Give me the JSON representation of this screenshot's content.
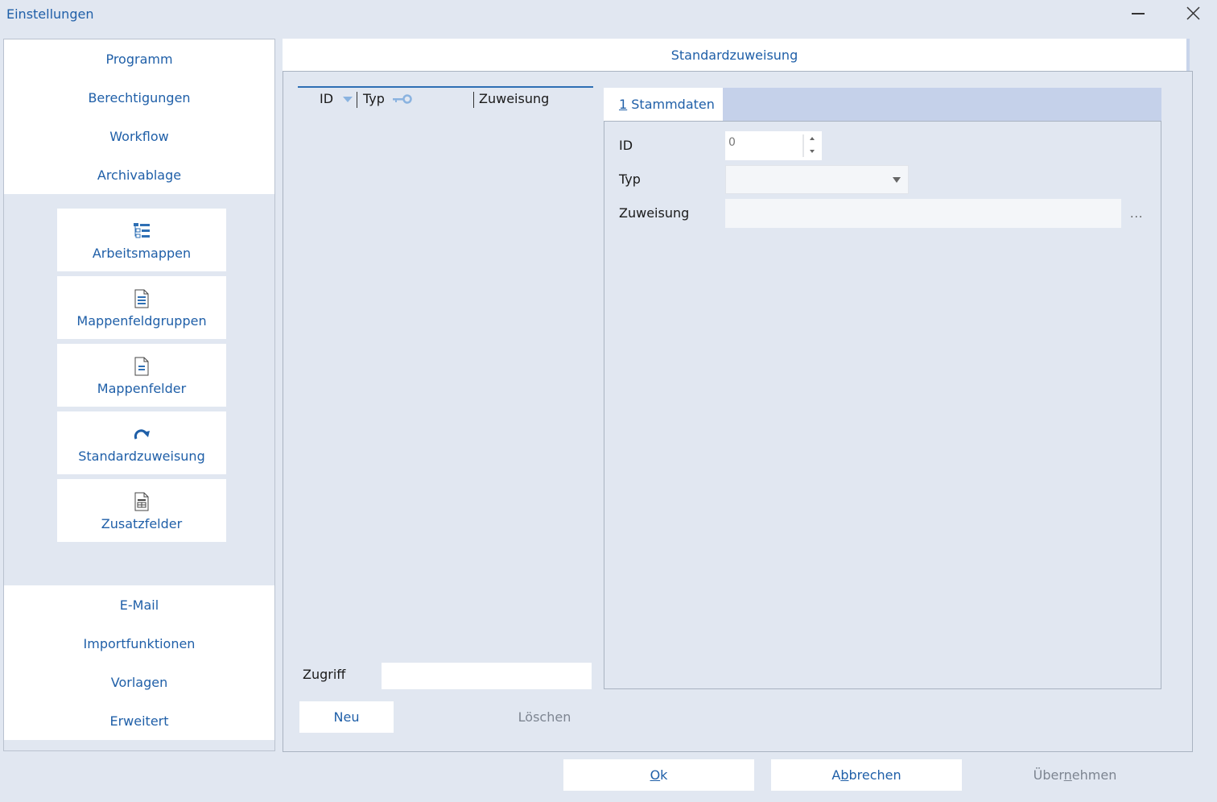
{
  "window": {
    "title": "Einstellungen"
  },
  "nav": {
    "top_items": [
      "Programm",
      "Berechtigungen",
      "Workflow",
      "Archivablage"
    ],
    "tiles": [
      "Arbeitsmappen",
      "Mappenfeldgruppen",
      "Mappenfelder",
      "Standardzuweisung",
      "Zusatzfelder"
    ],
    "bottom_items": [
      "E-Mail",
      "Importfunktionen",
      "Vorlagen",
      "Erweitert"
    ]
  },
  "panel": {
    "title": "Standardzuweisung"
  },
  "list": {
    "columns": [
      "ID",
      "Typ",
      "Zuweisung"
    ],
    "zugriff_label": "Zugriff",
    "zugriff_value": "",
    "new_label": "Neu",
    "delete_label": "Löschen"
  },
  "tab": {
    "key": "1",
    "label": " Stammdaten"
  },
  "form": {
    "id_label": "ID",
    "id_value": "0",
    "typ_label": "Typ",
    "typ_value": "",
    "zuweisung_label": "Zuweisung",
    "zuweisung_value": "",
    "browse_label": "..."
  },
  "footer": {
    "ok_key": "O",
    "ok_rest": "k",
    "cancel_pre": "A",
    "cancel_key": "b",
    "cancel_rest": "brechen",
    "apply_pre": "Über",
    "apply_key": "n",
    "apply_rest": "ehmen"
  },
  "colors": {
    "accent": "#1f5fa8",
    "background": "#e1e7f1",
    "tab_strip": "#c5d1ea"
  }
}
